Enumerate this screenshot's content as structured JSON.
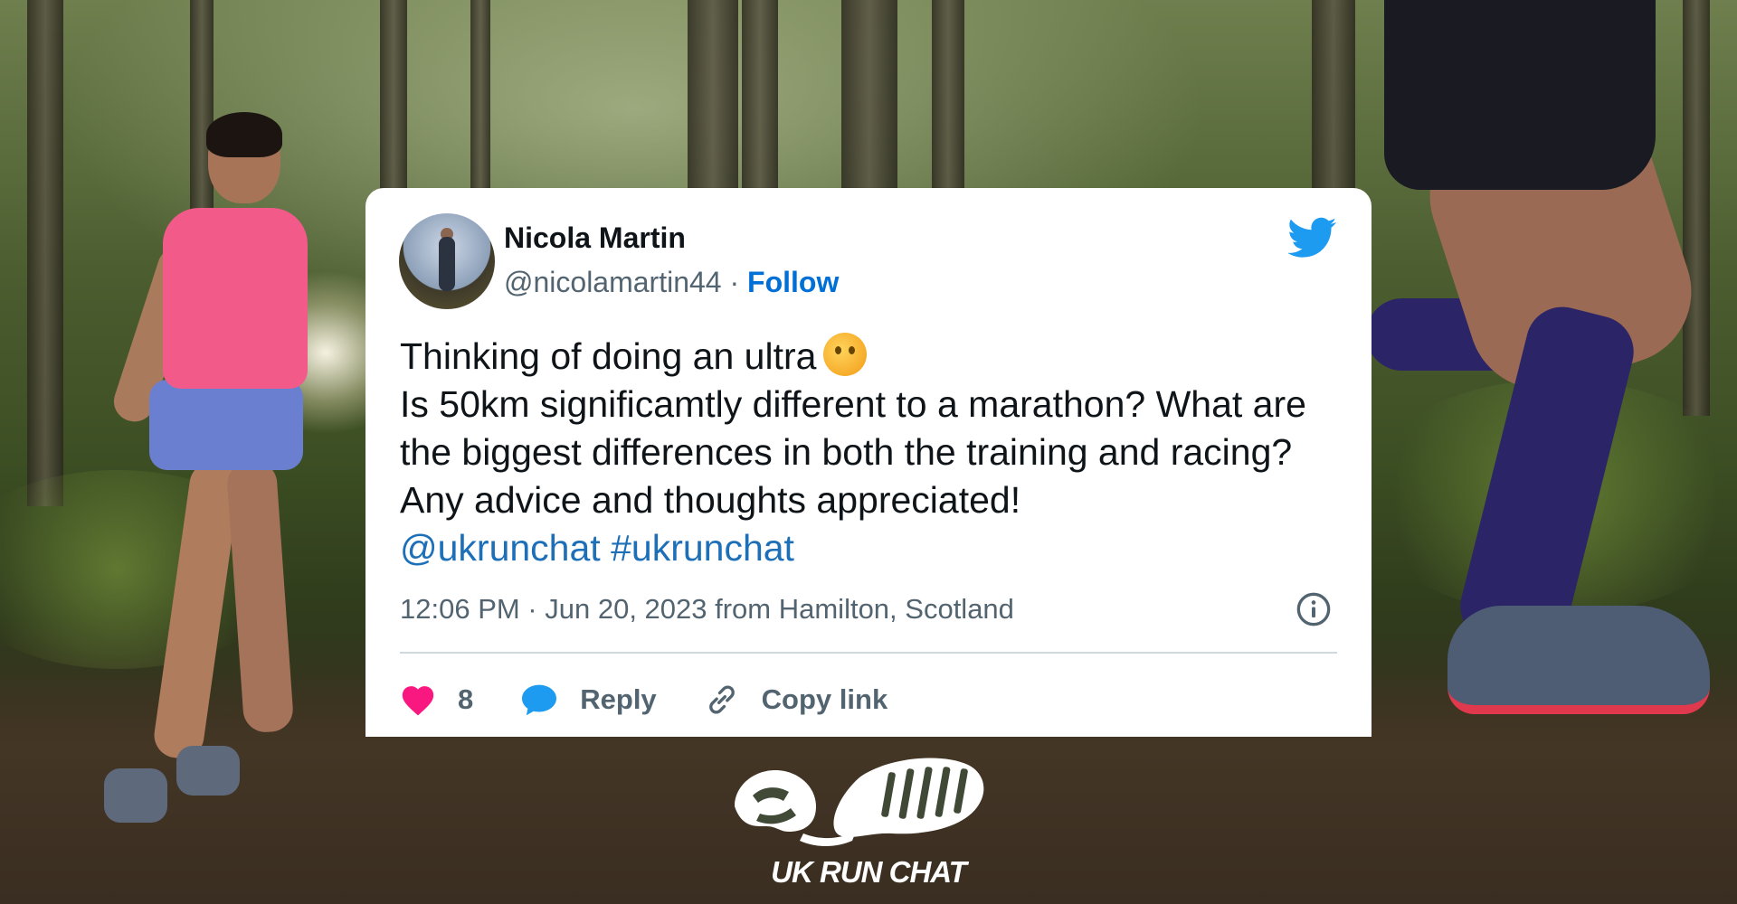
{
  "tweet": {
    "author_name": "Nicola Martin",
    "handle": "@nicolamartin44",
    "separator": "·",
    "follow_label": "Follow",
    "text_line1": "Thinking of doing an ultra",
    "text_body": "Is 50km significamtly different to a marathon? What are the biggest differences in both the training and racing? Any advice and thoughts appreciated!",
    "mention": "@ukrunchat",
    "hashtag": "#ukrunchat",
    "timestamp": "12:06 PM · Jun 20, 2023 from Hamilton, Scotland",
    "like_count": "8",
    "reply_label": "Reply",
    "copy_link_label": "Copy link",
    "emoji": "thinking-face"
  },
  "icons": {
    "brand": "twitter-bird-icon",
    "info": "info-icon",
    "like": "heart-icon",
    "reply": "speech-bubble-icon",
    "copy": "link-icon"
  },
  "colors": {
    "twitter_blue": "#1d9bf0",
    "follow_blue": "#006fd6",
    "heart_pink": "#f91880",
    "text_dark": "#0f1419",
    "text_muted": "#536471"
  },
  "branding": {
    "logo_text": "UK RUN CHAT"
  }
}
